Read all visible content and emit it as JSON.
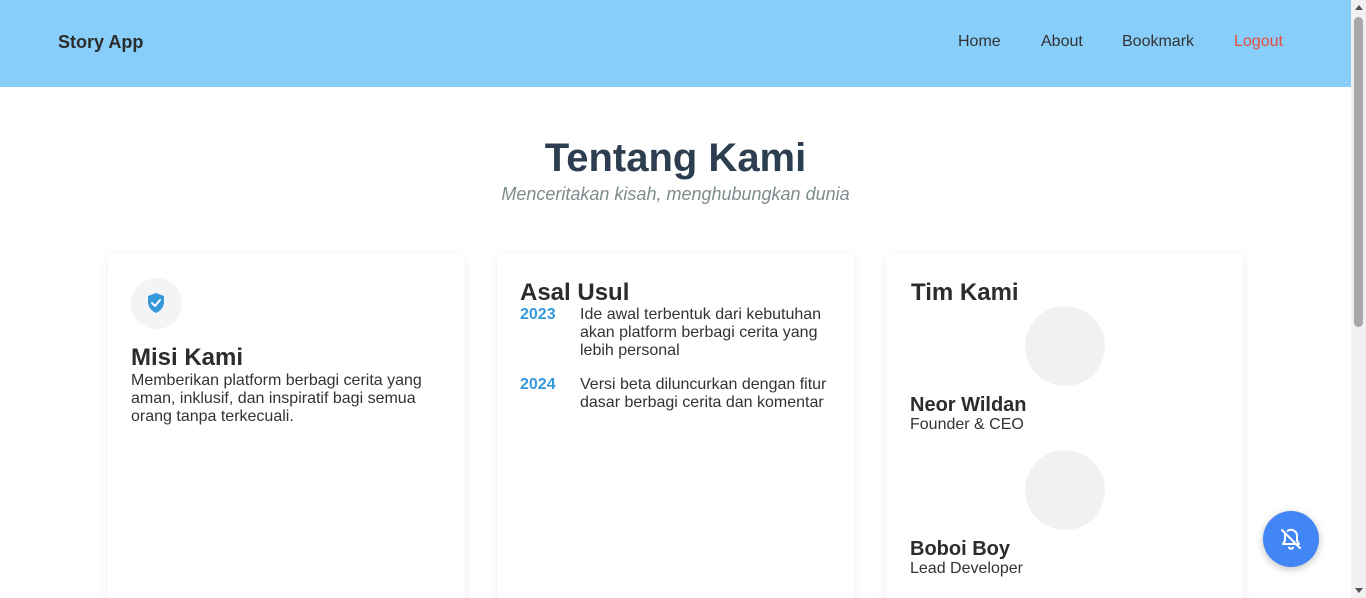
{
  "navbar": {
    "brand": "Story App",
    "links": [
      "Home",
      "About",
      "Bookmark"
    ],
    "logout": "Logout",
    "logout_color": "#e74c3c",
    "background_color": "#87cefa"
  },
  "hero": {
    "title": "Tentang Kami",
    "subtitle": "Menceritakan kisah, menghubungkan dunia"
  },
  "mission": {
    "icon": "shield-check-icon",
    "heading": "Misi Kami",
    "text": "Memberikan platform berbagi cerita yang aman, inklusif, dan inspiratif bagi semua orang tanpa terkecuali."
  },
  "origin": {
    "heading": "Asal Usul",
    "timeline": [
      {
        "year": "2023",
        "text": "Ide awal terbentuk dari kebutuhan akan platform berbagi cerita yang lebih personal"
      },
      {
        "year": "2024",
        "text": "Versi beta diluncurkan dengan fitur dasar berbagi cerita dan komentar"
      }
    ],
    "year_color": "#3498db"
  },
  "team": {
    "heading": "Tim Kami",
    "members": [
      {
        "name": "Neor Wildan",
        "role": "Founder & CEO"
      },
      {
        "name": "Boboi Boy",
        "role": "Lead Developer"
      }
    ]
  },
  "fab": {
    "icon": "bell-off-icon",
    "color": "#4285f4"
  }
}
